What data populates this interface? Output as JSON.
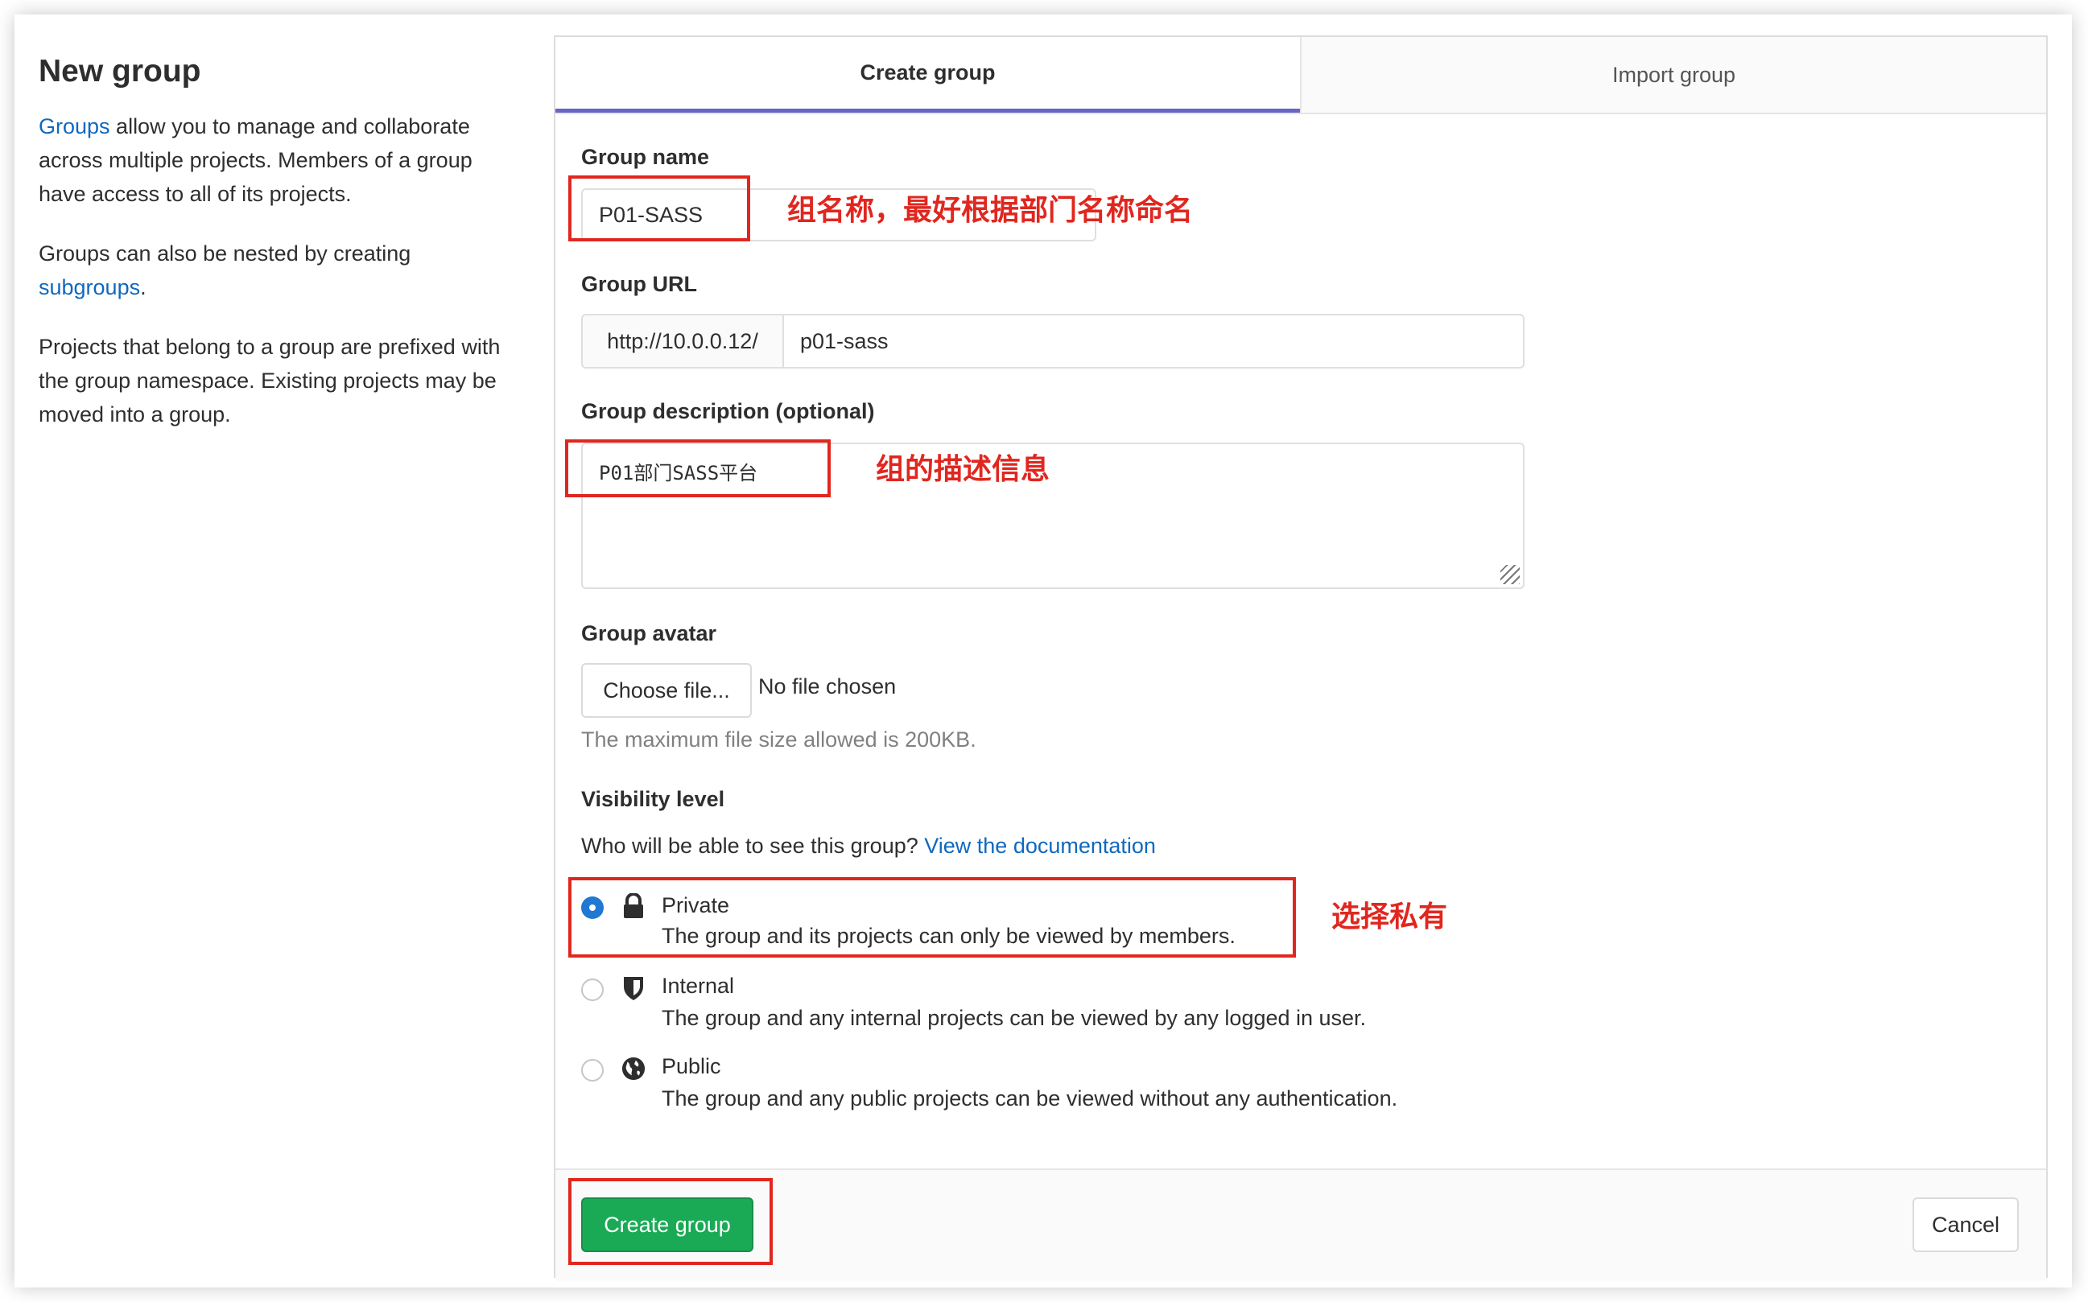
{
  "sidebar": {
    "title": "New group",
    "para1_link": "Groups",
    "para1_text": " allow you to manage and collaborate across multiple projects. Members of a group have access to all of its projects.",
    "para2_text": "Groups can also be nested by creating ",
    "para2_link": "subgroups",
    "para2_end": ".",
    "para3_text": "Projects that belong to a group are prefixed with the group namespace. Existing projects may be moved into a group."
  },
  "tabs": {
    "create": "Create group",
    "import": "Import group"
  },
  "form": {
    "group_name_label": "Group name",
    "group_name_value": "P01-SASS",
    "group_url_label": "Group URL",
    "group_url_prefix": "http://10.0.0.12/",
    "group_url_value": "p01-sass",
    "description_label": "Group description (optional)",
    "description_value": "P01部门SASS平台",
    "avatar_label": "Group avatar",
    "choose_file": "Choose file...",
    "no_file": "No file chosen",
    "max_size": "The maximum file size allowed is 200KB.",
    "visibility_label": "Visibility level",
    "visibility_question": "Who will be able to see this group? ",
    "visibility_doc_link": "View the documentation",
    "visibility_options": [
      {
        "label": "Private",
        "desc": "The group and its projects can only be viewed by members.",
        "checked": true,
        "icon": "lock-icon"
      },
      {
        "label": "Internal",
        "desc": "The group and any internal projects can be viewed by any logged in user.",
        "checked": false,
        "icon": "shield-icon"
      },
      {
        "label": "Public",
        "desc": "The group and any public projects can be viewed without any authentication.",
        "checked": false,
        "icon": "globe-icon"
      }
    ]
  },
  "footer": {
    "create_button": "Create group",
    "cancel_button": "Cancel"
  },
  "annotations": {
    "name_note": "组名称，最好根据部门名称命名",
    "description_note": "组的描述信息",
    "visibility_note": "选择私有",
    "color": "#e0271f"
  },
  "colors": {
    "link": "#1068bf",
    "primary_green": "#1aaa55",
    "radio_checked": "#1f78d1",
    "tab_active_border": "#6666c4"
  }
}
